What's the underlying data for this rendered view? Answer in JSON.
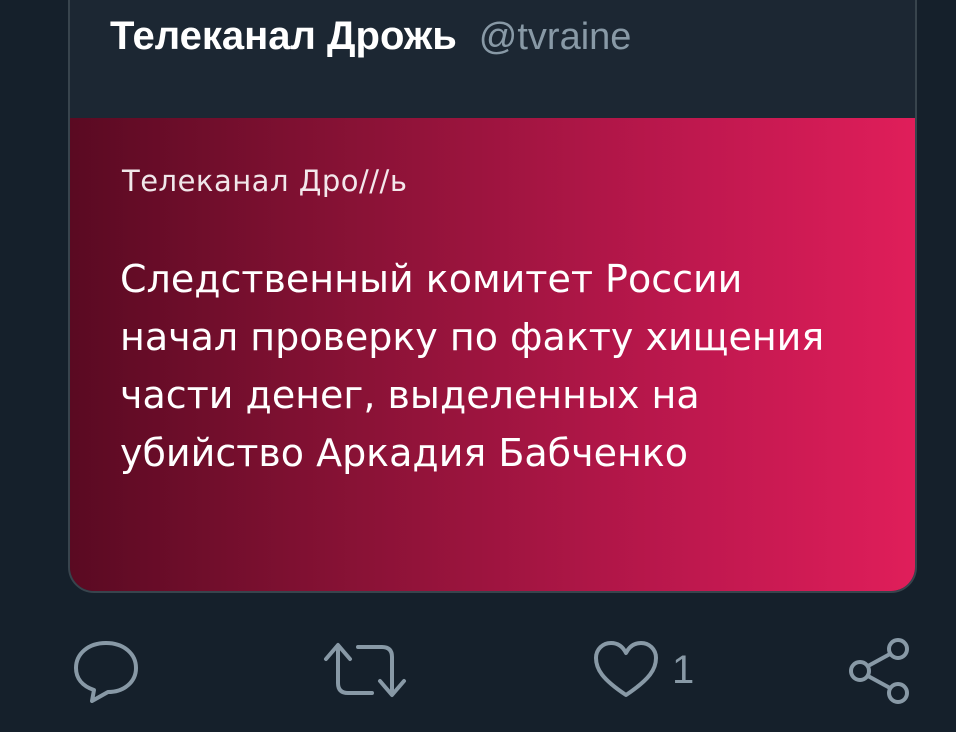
{
  "quote": {
    "author_name": "Телеканал Дрожь",
    "author_handle": "@tvraine",
    "image": {
      "wordmark": "Телеканал Дро///ь",
      "headline": "Следственный комитет России начал проверку по факту хищения части денег, выделенных на убийство Аркадия Бабченко"
    }
  },
  "actions": {
    "reply_icon": "reply-icon",
    "retweet_icon": "retweet-icon",
    "like_icon": "like-icon",
    "like_count": "1",
    "share_icon": "share-icon"
  },
  "colors": {
    "background": "#15202b",
    "card_border": "#38444d",
    "secondary_text": "#8899a6",
    "gradient_dark": "#5a0a22",
    "gradient_bright": "#e01e5a"
  }
}
